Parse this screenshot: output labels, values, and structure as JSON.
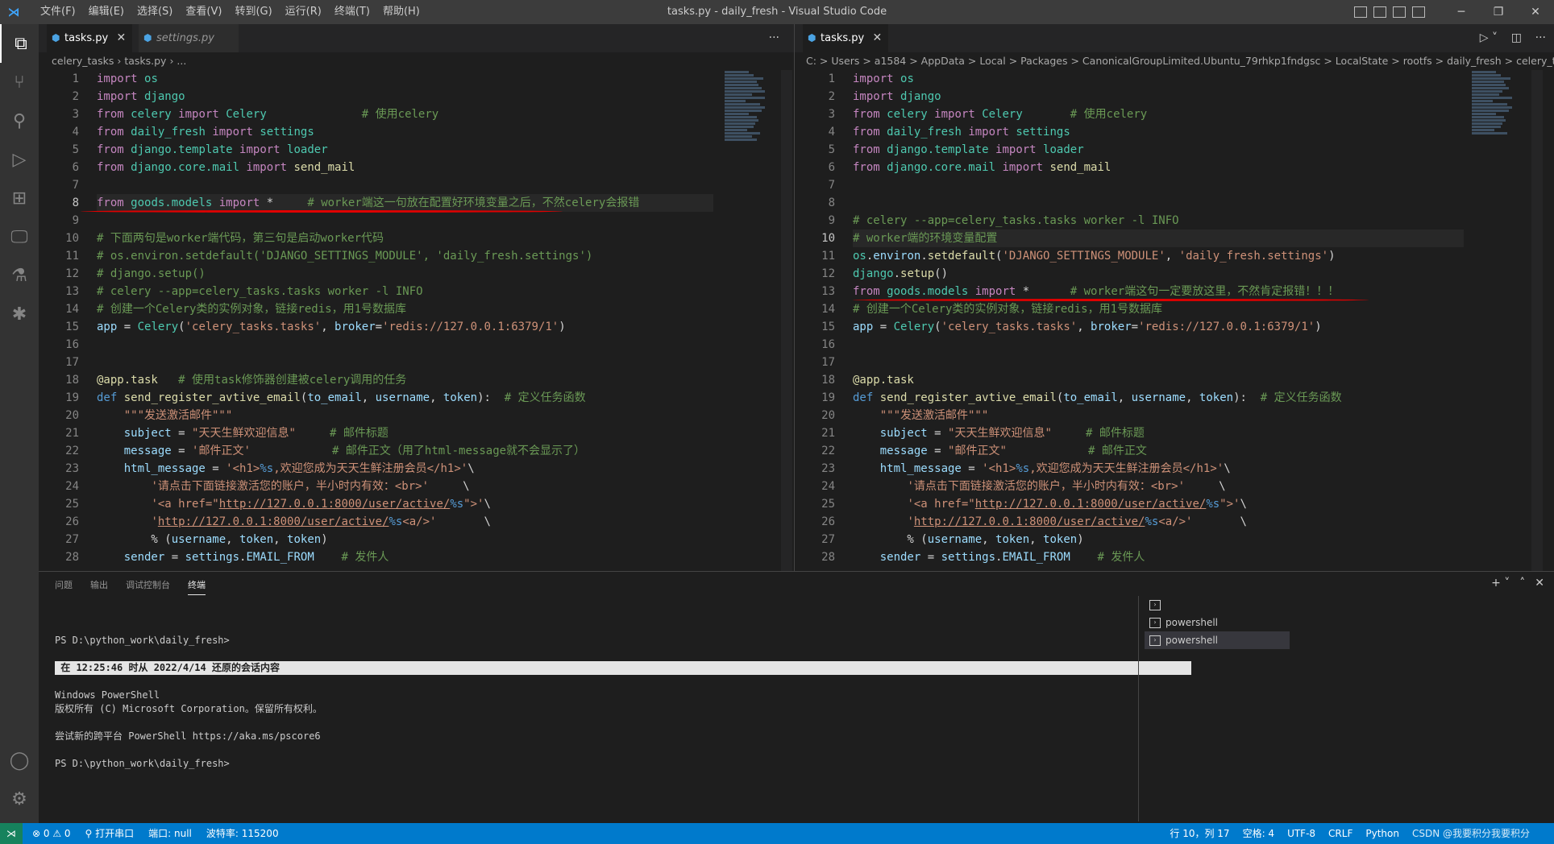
{
  "window": {
    "title": "tasks.py - daily_fresh - Visual Studio Code"
  },
  "menu": [
    "文件(F)",
    "编辑(E)",
    "选择(S)",
    "查看(V)",
    "转到(G)",
    "运行(R)",
    "终端(T)",
    "帮助(H)"
  ],
  "left_editor": {
    "tabs": [
      {
        "label": "tasks.py",
        "active": true
      },
      {
        "label": "settings.py",
        "active": false
      }
    ],
    "breadcrumb": [
      "celery_tasks",
      "tasks.py",
      "..."
    ],
    "current_line": 8
  },
  "right_editor": {
    "tabs": [
      {
        "label": "tasks.py",
        "active": true
      }
    ],
    "breadcrumb": "C: > Users > a1584 > AppData > Local > Packages > CanonicalGroupLimited.Ubuntu_79rhkp1fndgsc > LocalState > rootfs > daily_fresh > celery_tasks > task",
    "current_line": 10
  },
  "line_numbers": [
    "1",
    "2",
    "3",
    "4",
    "5",
    "6",
    "7",
    "8",
    "9",
    "10",
    "11",
    "12",
    "13",
    "14",
    "15",
    "16",
    "17",
    "18",
    "19",
    "20",
    "21",
    "22",
    "23",
    "24",
    "25",
    "26",
    "27",
    "28"
  ],
  "panel": {
    "tabs": [
      "问题",
      "输出",
      "调试控制台",
      "终端"
    ],
    "active_tab": "终端",
    "terminal_lines": [
      "",
      "PS D:\\python_work\\daily_fresh>",
      "",
      " 在 12:25:46 时从 2022/4/14 还原的会话内容",
      "",
      "Windows PowerShell",
      "版权所有 (C) Microsoft Corporation。保留所有权利。",
      "",
      "尝试新的跨平台 PowerShell https://aka.ms/pscore6",
      "",
      "PS D:\\python_work\\daily_fresh>"
    ],
    "shells": [
      "",
      "powershell",
      "powershell"
    ]
  },
  "statusbar": {
    "problems": "⊗ 0 ⚠ 0",
    "serial": "打开串口",
    "port": "端口: null",
    "baud": "波特率: 115200",
    "position": "行 10，列 17",
    "spaces": "空格: 4",
    "encoding": "UTF-8",
    "eol": "CRLF",
    "language": "Python",
    "watermark": "CSDN @我要积分我要积分"
  },
  "colors": {
    "accent": "#007acc",
    "annotation_red": "#e00000"
  }
}
